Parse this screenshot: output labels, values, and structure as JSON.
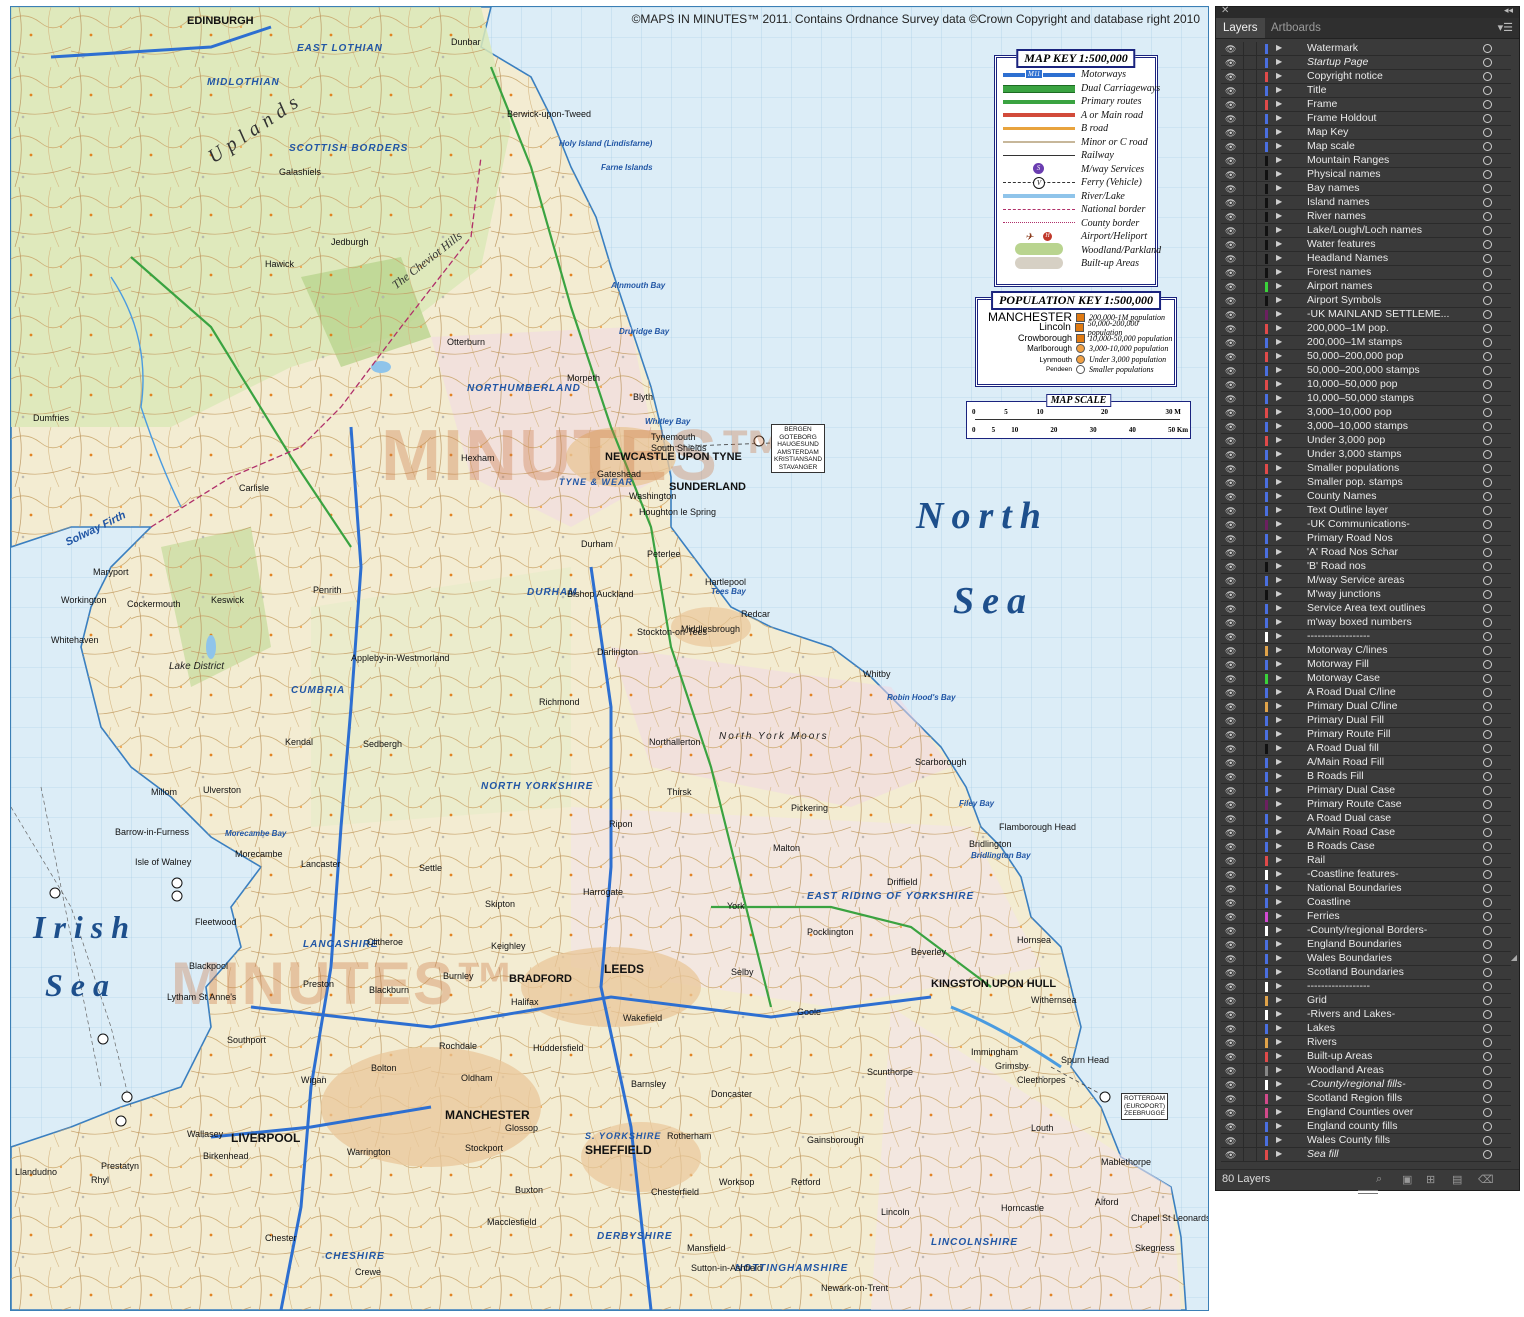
{
  "map": {
    "copyright": "©MAPS IN MINUTES™ 2011. Contains Ordnance Survey data ©Crown Copyright and database right 2010",
    "seas": {
      "north1": "North",
      "north2": "Sea",
      "irish1": "Irish",
      "irish2": "Sea"
    },
    "watermark": "MINUTES™",
    "cities": {
      "newcastle": "NEWCASTLE UPON TYNE",
      "sunderland": "SUNDERLAND",
      "leeds": "LEEDS",
      "bradford": "BRADFORD",
      "manchester": "MANCHESTER",
      "liverpool": "LIVERPOOL",
      "sheffield": "SHEFFIELD",
      "hull": "KINGSTON UPON HULL",
      "edinburgh": "EDINBURGH"
    },
    "counties": {
      "borders": "SCOTTISH BORDERS",
      "northumberland": "NORTHUMBERLAND",
      "cumbria": "CUMBRIA",
      "durham": "DURHAM",
      "nyorks": "NORTH YORKSHIRE",
      "eriding": "EAST RIDING OF YORKSHIRE",
      "lancashire": "LANCASHIRE",
      "lincolnshire": "LINCOLNSHIRE",
      "tyne": "TYNE & WEAR",
      "eastlothian": "EAST LOTHIAN",
      "midlothian": "MIDLOTHIAN",
      "derbyshire": "DERBYSHIRE",
      "syorks": "S. YORKSHIRE",
      "notts": "NOTTINGHAMSHIRE",
      "cheshire": "CHESHIRE"
    },
    "regions": {
      "uplands": "Uplands",
      "cheviot": "The Cheviot Hills",
      "lakedistrict": "Lake District",
      "nymoors": "North York Moors",
      "solway": "Solway Firth"
    },
    "places": {
      "p1": "Berwick-upon-Tweed",
      "p2": "Holy Island (Lindisfarne)",
      "p3": "Farne Islands",
      "p4": "Alnmouth Bay",
      "p5": "Druridge Bay",
      "p6": "Blyth",
      "p7": "Whitley Bay",
      "p8": "Tynemouth",
      "p9": "South Shields",
      "p10": "Gateshead",
      "p11": "Washington",
      "p12": "Houghton le Spring",
      "p13": "Durham",
      "p14": "Peterlee",
      "p15": "Hartlepool",
      "p16": "Tees Bay",
      "p17": "Redcar",
      "p18": "Middlesbrough",
      "p19": "Stockton-on-Tees",
      "p20": "Whitby",
      "p21": "Robin Hood's Bay",
      "p22": "Scarborough",
      "p23": "Filey Bay",
      "p24": "Flamborough Head",
      "p25": "Bridlington",
      "p26": "Bridlington Bay",
      "p27": "York",
      "p28": "Harrogate",
      "p29": "Keighley",
      "p30": "Halifax",
      "p31": "Huddersfield",
      "p32": "Wakefield",
      "p33": "Doncaster",
      "p34": "Scunthorpe",
      "p35": "Grimsby",
      "p36": "Cleethorpes",
      "p37": "Spurn Head",
      "p38": "Withernsea",
      "p39": "Beverley",
      "p40": "Carlisle",
      "p41": "Penrith",
      "p42": "Kendal",
      "p43": "Lancaster",
      "p44": "Morecambe",
      "p45": "Morecambe Bay",
      "p46": "Barrow-in-Furness",
      "p47": "Isle of Walney",
      "p48": "Blackpool",
      "p49": "Fleetwood",
      "p50": "Preston",
      "p51": "Blackburn",
      "p52": "Burnley",
      "p53": "Southport",
      "p54": "Wigan",
      "p55": "Bolton",
      "p56": "Rochdale",
      "p57": "Oldham",
      "p58": "Stockport",
      "p59": "Warrington",
      "p60": "Chester",
      "p61": "Workington",
      "p62": "Whitehaven",
      "p63": "Maryport",
      "p64": "Dumfries",
      "p65": "Galashiels",
      "p66": "Hawick",
      "p67": "Jedburgh",
      "p68": "Darlington",
      "p69": "Northallerton",
      "p70": "Ripon",
      "p71": "Selby",
      "p72": "Goole",
      "p73": "Barnsley",
      "p74": "Rotherham",
      "p75": "Chesterfield",
      "p76": "Lincoln",
      "p77": "Gainsborough",
      "p78": "Skegness",
      "p79": "Mablethorpe",
      "p80": "Louth",
      "p81": "Macclesfield",
      "p82": "Buxton",
      "p83": "Prestatyn",
      "p84": "Rhyl",
      "p85": "Llandudno",
      "p86": "Wallasey",
      "p87": "Birkenhead",
      "p88": "Crewe",
      "p89": "Mansfield",
      "p90": "Worksop",
      "p91": "Otterburn",
      "p92": "Hexham",
      "p93": "Morpeth",
      "p94": "Bishop Auckland",
      "p95": "Richmond",
      "p96": "Thirsk",
      "p97": "Malton",
      "p98": "Pickering",
      "p99": "Driffield",
      "p100": "Pocklington",
      "p101": "Skipton",
      "p102": "Settle",
      "p103": "Sedbergh",
      "p104": "Appleby-in-Westmorland",
      "p105": "Keswick",
      "p106": "Cockermouth",
      "p107": "Ulverston",
      "p108": "Millom",
      "p109": "Lytham St Anne's",
      "p110": "Clitheroe",
      "p111": "Hornsea",
      "p112": "Immingham",
      "p113": "Alford",
      "p114": "Chapel St Leonards",
      "p115": "Horncastle",
      "p116": "Retford",
      "p117": "Newark-on-Trent",
      "p118": "Sutton-in-Ashfield",
      "p119": "Glossop",
      "p120": "Dunbar"
    },
    "key": {
      "title": "MAP KEY 1:500,000",
      "m11": "M11",
      "rows": [
        "Motorways",
        "Dual Carriageways",
        "Primary routes",
        "A or Main road",
        "B road",
        "Minor or C road",
        "Railway",
        "M/way Services",
        "Ferry (Vehicle)",
        "River/Lake",
        "National border",
        "County border",
        "Airport/Heliport",
        "Woodland/Parkland",
        "Built-up Areas"
      ]
    },
    "popkey": {
      "title": "POPULATION KEY 1:500,000",
      "rows": [
        {
          "name": "MANCHESTER",
          "label": "200,000-1M population",
          "color": "#e07a12"
        },
        {
          "name": "Lincoln",
          "label": "50,000-200,000 population",
          "color": "#e07a12"
        },
        {
          "name": "Crowborough",
          "label": "10,000-50,000 population",
          "color": "#e07a12"
        },
        {
          "name": "Marlborough",
          "label": "3,000-10,000 population",
          "color": "#f2a144"
        },
        {
          "name": "Lynmouth",
          "label": "Under 3,000 population",
          "color": "#f2a144"
        },
        {
          "name": "Pendeen",
          "label": "Smaller populations",
          "color": "#ffffff"
        }
      ]
    },
    "scale": {
      "title": "MAP SCALE",
      "miles": [
        "0",
        "5",
        "10",
        "20",
        "30 M"
      ],
      "km": [
        "0",
        "5",
        "10",
        "20",
        "30",
        "40",
        "50 Km"
      ]
    },
    "ferries": {
      "north": "BERGEN\nGOTEBORG\nHAUGESUND\nAMSTERDAM\nKRISTIANSAND\nSTAVANGER",
      "east": "ROTTERDAM\n(EUROPORT)\nZEEBRUGGE"
    }
  },
  "panel": {
    "tabs": [
      "Layers",
      "Artboards"
    ],
    "count": "80 Layers",
    "layers": [
      {
        "name": "Watermark",
        "color": "#4a6fe0"
      },
      {
        "name": "Startup Page",
        "color": "#4a6fe0",
        "italic": true
      },
      {
        "name": "Copyright notice",
        "color": "#e04a4a"
      },
      {
        "name": "Title",
        "color": "#4a6fe0"
      },
      {
        "name": "Frame",
        "color": "#e04a4a"
      },
      {
        "name": "Frame Holdout",
        "color": "#4a6fe0"
      },
      {
        "name": "Map Key",
        "color": "#4a6fe0"
      },
      {
        "name": "Map scale",
        "color": "#4a6fe0"
      },
      {
        "name": "Mountain Ranges",
        "color": "#111111"
      },
      {
        "name": "Physical names",
        "color": "#111111"
      },
      {
        "name": "Bay names",
        "color": "#111111"
      },
      {
        "name": "Island names",
        "color": "#111111"
      },
      {
        "name": "River names",
        "color": "#111111"
      },
      {
        "name": "Lake/Lough/Loch names",
        "color": "#111111"
      },
      {
        "name": "Water features",
        "color": "#111111"
      },
      {
        "name": "Headland Names",
        "color": "#111111"
      },
      {
        "name": "Forest names",
        "color": "#111111"
      },
      {
        "name": "Airport names",
        "color": "#3ad13a"
      },
      {
        "name": "Airport Symbols",
        "color": "#111111"
      },
      {
        "name": "-UK MAINLAND SETTLEME...",
        "color": "#6b1f5f"
      },
      {
        "name": "200,000–1M pop.",
        "color": "#e04a4a"
      },
      {
        "name": "200,000–1M stamps",
        "color": "#4a6fe0"
      },
      {
        "name": "50,000–200,000 pop",
        "color": "#e04a4a"
      },
      {
        "name": "50,000–200,000 stamps",
        "color": "#4a6fe0"
      },
      {
        "name": "10,000–50,000 pop",
        "color": "#e04a4a"
      },
      {
        "name": "10,000–50,000 stamps",
        "color": "#4a6fe0"
      },
      {
        "name": "3,000–10,000 pop",
        "color": "#e04a4a"
      },
      {
        "name": "3,000–10,000 stamps",
        "color": "#4a6fe0"
      },
      {
        "name": "Under 3,000 pop",
        "color": "#e04a4a"
      },
      {
        "name": "Under 3,000 stamps",
        "color": "#4a6fe0"
      },
      {
        "name": "Smaller populations",
        "color": "#e04a4a"
      },
      {
        "name": "Smaller pop. stamps",
        "color": "#4a6fe0"
      },
      {
        "name": "County Names",
        "color": "#4a6fe0"
      },
      {
        "name": "Text Outline layer",
        "color": "#4a6fe0"
      },
      {
        "name": "-UK Communications-",
        "color": "#6b1f5f"
      },
      {
        "name": "Primary Road Nos",
        "color": "#4a6fe0"
      },
      {
        "name": "'A' Road Nos Schar",
        "color": "#4a6fe0"
      },
      {
        "name": "'B' Road nos",
        "color": "#111111"
      },
      {
        "name": "M/way Service areas",
        "color": "#4a6fe0"
      },
      {
        "name": "M'way junctions",
        "color": "#111111"
      },
      {
        "name": "Service Area text outlines",
        "color": "#4a6fe0"
      },
      {
        "name": "m'way boxed numbers",
        "color": "#4a6fe0"
      },
      {
        "name": "------------------",
        "color": "#ffffff"
      },
      {
        "name": "Motorway C/lines",
        "color": "#e0a34a"
      },
      {
        "name": "Motorway Fill",
        "color": "#4a6fe0"
      },
      {
        "name": "Motorway Case",
        "color": "#3ad13a"
      },
      {
        "name": "A Road Dual C/line",
        "color": "#4a6fe0"
      },
      {
        "name": "Primary Dual C/line",
        "color": "#e0a34a"
      },
      {
        "name": "Primary Dual Fill",
        "color": "#4a6fe0"
      },
      {
        "name": "Primary Route Fill",
        "color": "#4a6fe0"
      },
      {
        "name": "A Road Dual fill",
        "color": "#111111"
      },
      {
        "name": "A/Main Road Fill",
        "color": "#4a6fe0"
      },
      {
        "name": "B Roads Fill",
        "color": "#4a6fe0"
      },
      {
        "name": "Primary Dual Case",
        "color": "#4a6fe0"
      },
      {
        "name": "Primary Route Case",
        "color": "#6b1f5f"
      },
      {
        "name": "A Road Dual case",
        "color": "#4a6fe0"
      },
      {
        "name": "A/Main Road Case",
        "color": "#4a6fe0"
      },
      {
        "name": "B Roads Case",
        "color": "#4a6fe0"
      },
      {
        "name": "Rail",
        "color": "#e04a4a"
      },
      {
        "name": "-Coastline features-",
        "color": "#ffffff"
      },
      {
        "name": "National Boundaries",
        "color": "#4a6fe0"
      },
      {
        "name": "Coastline",
        "color": "#4a6fe0"
      },
      {
        "name": "Ferries",
        "color": "#d14ad1"
      },
      {
        "name": "-County/regional Borders-",
        "color": "#ffffff"
      },
      {
        "name": "England Boundaries",
        "color": "#4a6fe0"
      },
      {
        "name": "Wales Boundaries",
        "color": "#4a6fe0"
      },
      {
        "name": "Scotland Boundaries",
        "color": "#4a6fe0"
      },
      {
        "name": "------------------",
        "color": "#ffffff"
      },
      {
        "name": "Grid",
        "color": "#e0a34a"
      },
      {
        "name": "-Rivers and Lakes-",
        "color": "#ffffff"
      },
      {
        "name": "Lakes",
        "color": "#4a6fe0"
      },
      {
        "name": "Rivers",
        "color": "#e0a34a"
      },
      {
        "name": "Built-up Areas",
        "color": "#e04a4a"
      },
      {
        "name": "Woodland Areas",
        "color": "#888888"
      },
      {
        "name": "-County/regional fills-",
        "color": "#ffffff",
        "italic": true
      },
      {
        "name": "Scotland Region fills",
        "color": "#d14a8a"
      },
      {
        "name": "England Counties over",
        "color": "#d14a8a"
      },
      {
        "name": "England county fills",
        "color": "#4a6fe0"
      },
      {
        "name": "Wales County fills",
        "color": "#4a6fe0"
      },
      {
        "name": "Sea fill",
        "color": "#e04a4a",
        "italic": true
      }
    ]
  }
}
